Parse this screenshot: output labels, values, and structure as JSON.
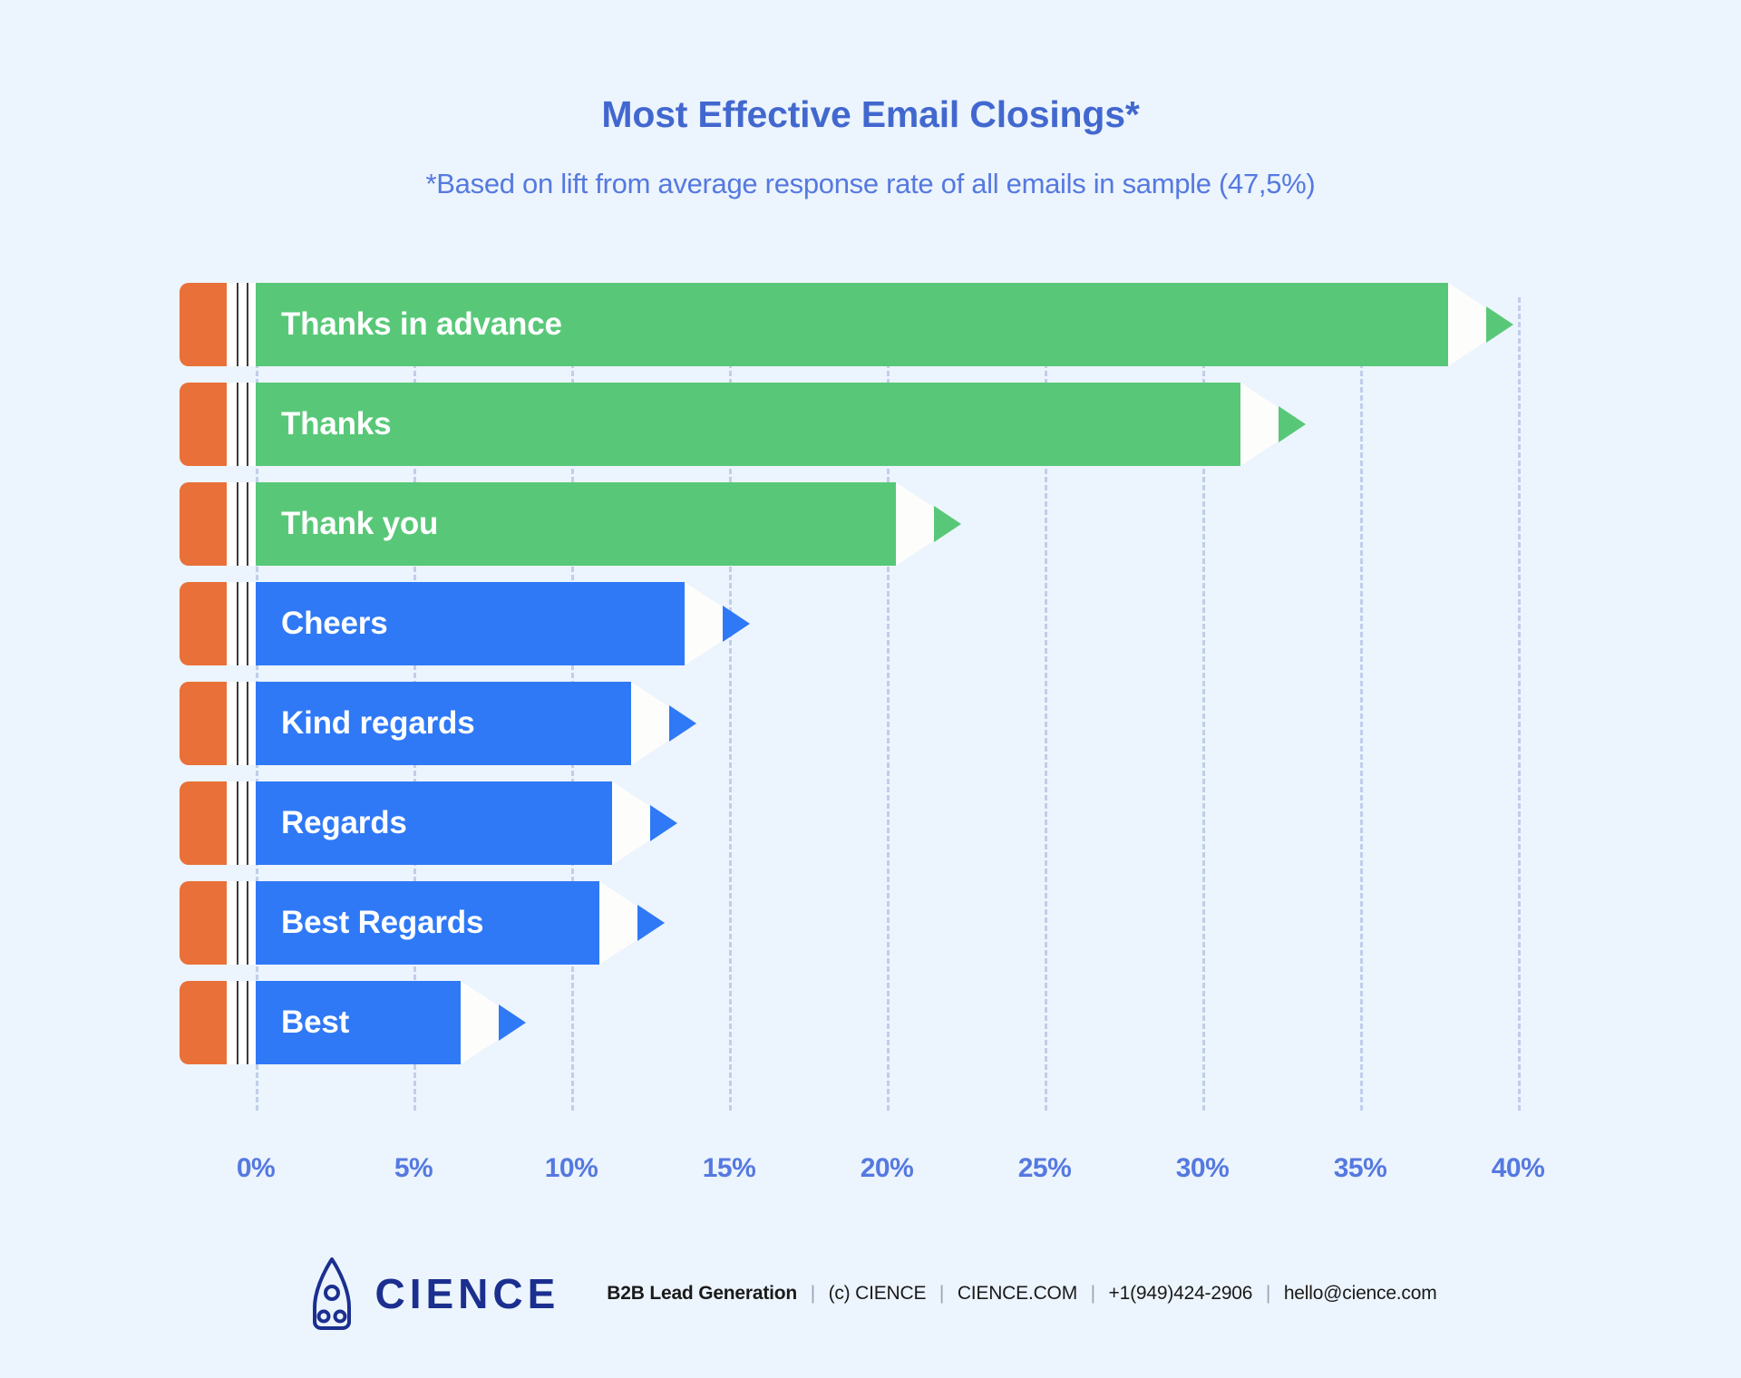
{
  "header": {
    "title": "Most Effective Email Closings*",
    "subtitle": "*Based on lift from average response rate of all emails in sample (47,5%)"
  },
  "colors": {
    "background": "#ecf4fd",
    "title": "#4268cf",
    "subtitle": "#5579e0",
    "green": "#58c878",
    "blue": "#2f79f6",
    "eraser_orange": "#e97038",
    "gridline": "#b9c8e6",
    "bar_label": "#ffffff",
    "tick_label": "#5579e0",
    "logo": "#1b2f8f"
  },
  "chart_data": {
    "type": "bar",
    "orientation": "horizontal",
    "title": "Most Effective Email Closings*",
    "subtitle": "*Based on lift from average response rate of all emails in sample (47,5%)",
    "xlabel": "",
    "ylabel": "",
    "xlim": [
      0,
      40
    ],
    "grid": true,
    "legend": null,
    "tick_labels": [
      "0%",
      "5%",
      "10%",
      "15%",
      "20%",
      "25%",
      "30%",
      "35%",
      "40%"
    ],
    "tick_values": [
      0,
      5,
      10,
      15,
      20,
      25,
      30,
      35,
      40
    ],
    "categories": [
      "Thanks in advance",
      "Thanks",
      "Thank you",
      "Cheers",
      "Kind regards",
      "Regards",
      "Best Regards",
      "Best"
    ],
    "values": [
      37.8,
      31.2,
      20.3,
      13.6,
      11.9,
      11.3,
      10.9,
      6.5
    ],
    "value_colors": [
      "#58c878",
      "#58c878",
      "#58c878",
      "#2f79f6",
      "#2f79f6",
      "#2f79f6",
      "#2f79f6",
      "#2f79f6"
    ]
  },
  "bars": [
    {
      "label": "Thanks in advance",
      "value": 37.8,
      "color": "#58c878"
    },
    {
      "label": "Thanks",
      "value": 31.2,
      "color": "#58c878"
    },
    {
      "label": "Thank you",
      "value": 20.3,
      "color": "#58c878"
    },
    {
      "label": "Cheers",
      "value": 13.6,
      "color": "#2f79f6"
    },
    {
      "label": "Kind regards",
      "value": 11.9,
      "color": "#2f79f6"
    },
    {
      "label": "Regards",
      "value": 11.3,
      "color": "#2f79f6"
    },
    {
      "label": "Best Regards",
      "value": 10.9,
      "color": "#2f79f6"
    },
    {
      "label": "Best",
      "value": 6.5,
      "color": "#2f79f6"
    }
  ],
  "axis": {
    "ticks": [
      "0%",
      "5%",
      "10%",
      "15%",
      "20%",
      "25%",
      "30%",
      "35%",
      "40%"
    ]
  },
  "footer": {
    "logo_name": "CIENCE",
    "logo_icon": "rocket-icon",
    "tagline": "B2B Lead Generation",
    "copyright": "(c) CIENCE",
    "website": "CIENCE.COM",
    "phone": "+1(949)424-2906",
    "email": "hello@cience.com",
    "separator": "|"
  }
}
